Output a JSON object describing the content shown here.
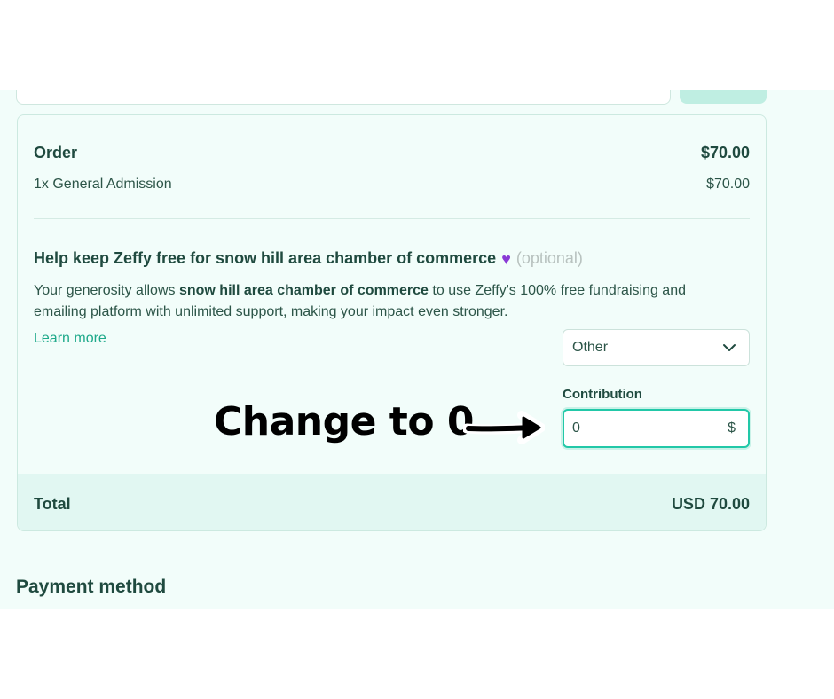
{
  "order": {
    "title": "Order",
    "amount": "$70.00",
    "item_label": "1x General Admission",
    "item_amount": "$70.00"
  },
  "tip": {
    "title": "Help keep Zeffy free for snow hill area chamber of commerce",
    "heart_icon": "purple-heart-icon",
    "optional": "(optional)",
    "text_1": "Your generosity allows ",
    "org_name": "snow hill area chamber of commerce",
    "text_2": " to use Zeffy's 100% free fundraising and emailing platform with unlimited support, making your impact even stronger.",
    "learn_more": "Learn more",
    "select_value": "Other",
    "contribution_label": "Contribution",
    "contribution_value": "0",
    "currency_symbol": "$"
  },
  "total": {
    "label": "Total",
    "amount": "USD 70.00"
  },
  "payment": {
    "heading": "Payment method"
  },
  "annotation": {
    "text": "Change to 0"
  },
  "colors": {
    "accent": "#22c8a8",
    "link": "#1ea98a",
    "heading": "#1f4a3f",
    "background": "#f2fdfa"
  }
}
